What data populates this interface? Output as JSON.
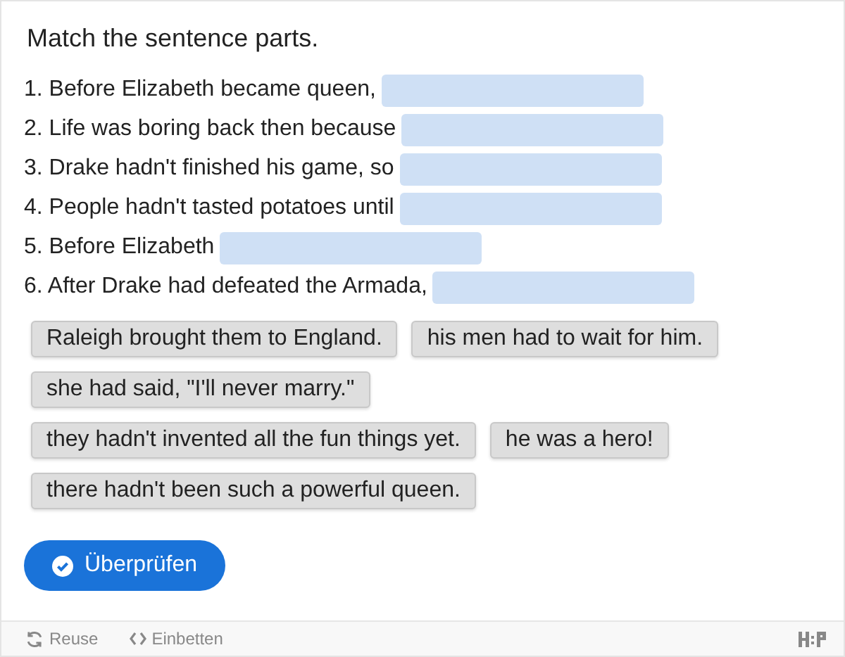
{
  "title": "Match the sentence parts.",
  "sentences": [
    {
      "text": "1. Before Elizabeth became queen,"
    },
    {
      "text": "2. Life was boring back then because"
    },
    {
      "text": "3. Drake hadn't finished his game, so"
    },
    {
      "text": "4. People hadn't tasted potatoes until"
    },
    {
      "text": "5. Before Elizabeth"
    },
    {
      "text": "6. After Drake had defeated the Armada,"
    }
  ],
  "options": [
    "Raleigh brought them to England.",
    "his men had to wait for him.",
    "she had said, \"I'll never marry.\"",
    "they hadn't invented all the fun things yet.",
    "he was a hero!",
    "there hadn't been such a powerful queen."
  ],
  "check_button": "Überprüfen",
  "footer": {
    "reuse": "Reuse",
    "embed": "Einbetten"
  }
}
